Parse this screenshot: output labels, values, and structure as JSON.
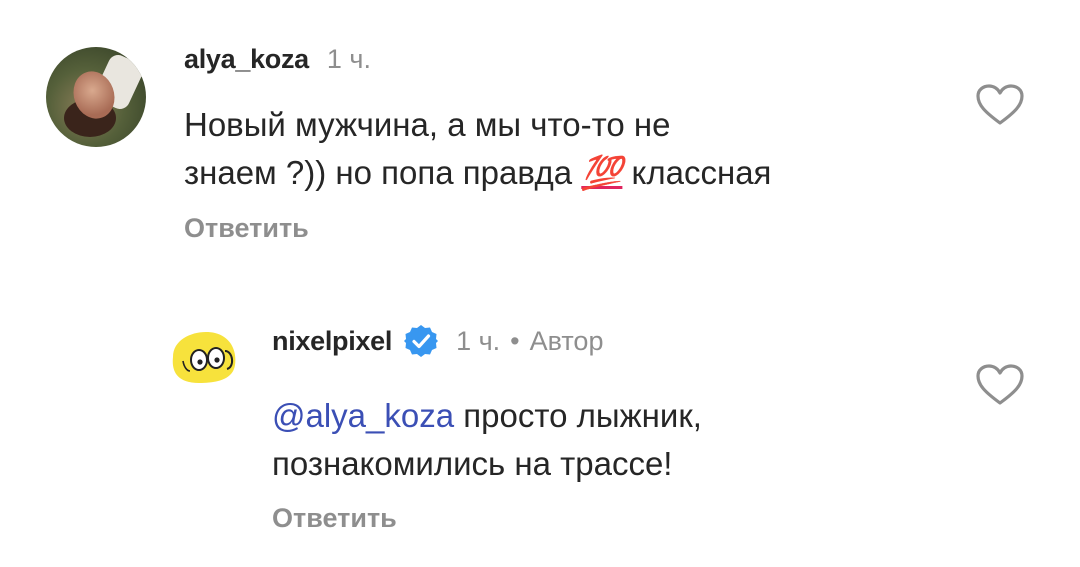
{
  "comments": [
    {
      "username": "alya_koza",
      "time": "1 ч.",
      "text_line1": "Новый мужчина, а мы что-то не",
      "text_line2_before": "знаем ?)) но попа правда ",
      "emoji": "💯",
      "text_line2_after": " классная",
      "reply_label": "Ответить",
      "like_icon": "heart-icon"
    },
    {
      "username": "nixelpixel",
      "verified_icon": "verified-badge-icon",
      "time": "1 ч.",
      "separator": "•",
      "author_label": "Автор",
      "mention": "@alya_koza",
      "text_line1_after": " просто лыжник,",
      "text_line2": "познакомились на трассе!",
      "reply_label": "Ответить",
      "like_icon": "heart-icon"
    }
  ],
  "colors": {
    "text": "#262626",
    "secondary": "#8e8e8e",
    "mention": "#3b4fb5",
    "verified": "#3897f0",
    "avatar_yellow": "#f7e23c"
  }
}
